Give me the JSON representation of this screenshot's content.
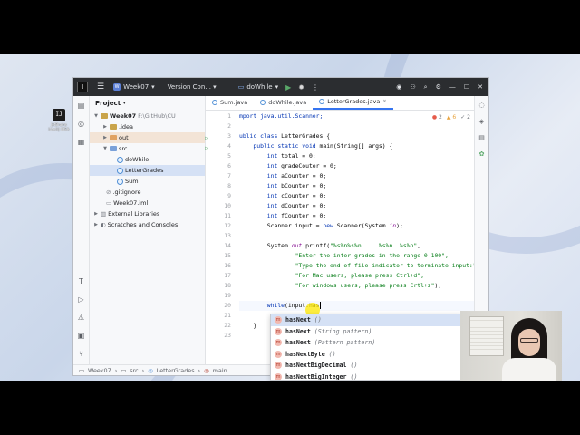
{
  "desktop": {
    "icon_label": "JetBrains IntelliJ IDEA"
  },
  "titlebar": {
    "project_badge": "W",
    "project": "Week07",
    "vcs": "Version Con...",
    "run_config": "doWhile"
  },
  "project_panel": {
    "header": "Project",
    "items": [
      {
        "label": "Week07",
        "path": "F:\\GitHub\\CU"
      },
      {
        "label": ".idea"
      },
      {
        "label": "out"
      },
      {
        "label": "src"
      },
      {
        "label": "doWhile"
      },
      {
        "label": "LetterGrades"
      },
      {
        "label": "Sum"
      },
      {
        "label": ".gitignore"
      },
      {
        "label": "Week07.iml"
      },
      {
        "label": "External Libraries"
      },
      {
        "label": "Scratches and Consoles"
      }
    ]
  },
  "tabs": [
    {
      "label": "Sum.java"
    },
    {
      "label": "doWhile.java"
    },
    {
      "label": "LetterGrades.java"
    }
  ],
  "inspections": {
    "errors": "2",
    "warnings": "6",
    "typos": "2"
  },
  "code": {
    "line_numbers": [
      "1",
      "2",
      "3",
      "4",
      "5",
      "6",
      "7",
      "8",
      "9",
      "10",
      "11",
      "12",
      "13",
      "14",
      "15",
      "16",
      "17",
      "18",
      "19",
      "20",
      "21",
      "22",
      "23"
    ],
    "l1": "mport java.util.Scanner;",
    "l3a": "ublic class",
    "l3b": " LetterGrades {",
    "l4a": "public static void",
    "l4b": " main(String[] args) {",
    "l5a": "int",
    "l5b": " total = 0;",
    "l6a": "int",
    "l6b": " gradeCouter = 0;",
    "l7a": "int",
    "l7b": " aCounter = 0;",
    "l8a": "int",
    "l8b": " bCounter = 0;",
    "l9a": "int",
    "l9b": " cCounter = 0;",
    "l10a": "int",
    "l10b": " dCounter = 0;",
    "l11a": "int",
    "l11b": " fCounter = 0;",
    "l12a": "Scanner input = ",
    "l12b": "new",
    "l12c": " Scanner(System.",
    "l12d": "in",
    "l12e": ");",
    "l14a": "System.",
    "l14b": "out",
    "l14c": ".printf(",
    "l14d": "\"%s%n%s%n     %s%n  %s%n\"",
    "l14e": ",",
    "l15": "\"Enter the inter grades in the range 0-100\",",
    "l16": "\"Type the end-of-file indicator to terminate input:\",",
    "l17": "\"For Mac users, please press Ctrl+d\",",
    "l18a": "\"For windows users, please press Crtl+z\"",
    "l18b": ");",
    "l20a": "while",
    "l20b": "(input.has",
    "l22": "}"
  },
  "completion": [
    {
      "name": "hasNext",
      "params": "()"
    },
    {
      "name": "hasNext",
      "params": "(String pattern)"
    },
    {
      "name": "hasNext",
      "params": "(Pattern pattern)"
    },
    {
      "name": "hasNextByte",
      "params": "()"
    },
    {
      "name": "hasNextBigDecimal",
      "params": "()"
    },
    {
      "name": "hasNextBigInteger",
      "params": "()"
    }
  ],
  "completion_icon": "m",
  "statusbar": [
    "Week07",
    "src",
    "LetterGrades",
    "main"
  ]
}
